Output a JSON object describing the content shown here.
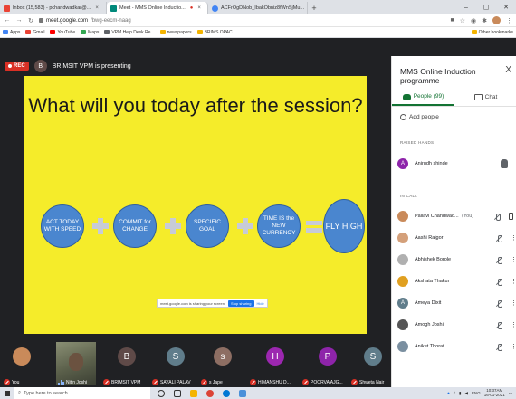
{
  "browser": {
    "tabs": [
      {
        "label": "Inbox (15,583) - pchandwadkar@...",
        "color": "#ea4335",
        "active": false
      },
      {
        "label": "Meet - MMS Online Inductio...",
        "color": "#00897b",
        "active": true
      },
      {
        "label": "ACFrOgDNob_IbakObniz8fWnSjMu...",
        "color": "#4285f4",
        "active": false
      }
    ],
    "new_tab": "+",
    "url_host": "meet.google.com",
    "url_path": "/bwg-eecm-naag",
    "bookmarks": [
      {
        "label": "Apps",
        "color": "#4285f4"
      },
      {
        "label": "Gmail",
        "color": "#ea4335"
      },
      {
        "label": "YouTube",
        "color": "#ff0000"
      },
      {
        "label": "Maps",
        "color": "#34a853"
      },
      {
        "label": "VPM Help Desk Re...",
        "color": "#5f6368"
      },
      {
        "label": "newspapers",
        "color": "#f4b400"
      },
      {
        "label": "BRIMS OPAC",
        "color": "#f4b400"
      }
    ],
    "other_bookmarks": "Other bookmarks"
  },
  "meet": {
    "rec_label": "REC",
    "presenter_initial": "B",
    "presenting_text": "BRIMSIT VPM is presenting",
    "slide": {
      "title": "What will you today after the session?",
      "steps": [
        "ACT TODAY WITH SPEED",
        "COMMIT for CHANGE",
        "SPECIFIC GOAL",
        "TIME IS the NEW CURRENCY"
      ],
      "result": "FLY HIGH"
    },
    "share_notice": "meet.google.com is sharing your screen.",
    "stop_sharing": "Stop sharing",
    "hide": "Hide",
    "participants_strip": [
      {
        "name": "You",
        "initial": "",
        "color": "#c98a5a",
        "muted": true
      },
      {
        "name": "Nitin Joshi",
        "initial": "",
        "color": "#6b5240",
        "muted": false
      },
      {
        "name": "BRIMSIT VPM",
        "initial": "B",
        "color": "#5f4a48",
        "muted": true
      },
      {
        "name": "SAYALI PALAV",
        "initial": "S",
        "color": "#607d8b",
        "muted": true
      },
      {
        "name": "s Jape",
        "initial": "s",
        "color": "#8d6e63",
        "muted": true
      },
      {
        "name": "HIMANSHU D...",
        "initial": "H",
        "color": "#9c27b0",
        "muted": true
      },
      {
        "name": "POORVA AJG...",
        "initial": "P",
        "color": "#8e24aa",
        "muted": true
      },
      {
        "name": "Shweta Nair",
        "initial": "S",
        "color": "#607d8b",
        "muted": true
      }
    ]
  },
  "panel": {
    "title": "MMS Online Induction programme",
    "close": "X",
    "tab_people": "People (99)",
    "tab_chat": "Chat",
    "add_people": "Add people",
    "raised_hands_label": "RAISED HANDS",
    "raised": [
      {
        "name": "Anirudh shinde",
        "initial": "A",
        "color": "#8e24aa"
      }
    ],
    "in_call_label": "IN CALL",
    "in_call": [
      {
        "name": "Pallavi Chandwad...",
        "you": "(You)",
        "color": "#c98a5a",
        "initial": ""
      },
      {
        "name": "Aashi Rajgor",
        "you": "",
        "color": "#d4a07a",
        "initial": ""
      },
      {
        "name": "Abhishek Borole",
        "you": "",
        "color": "#b0b0b0",
        "initial": ""
      },
      {
        "name": "Akshata Thakur",
        "you": "",
        "color": "#e0a020",
        "initial": ""
      },
      {
        "name": "Ameya Dixit",
        "you": "",
        "color": "#607d8b",
        "initial": "A"
      },
      {
        "name": "Amogh Joshi",
        "you": "",
        "color": "#555555",
        "initial": ""
      },
      {
        "name": "Aniket Thorat",
        "you": "",
        "color": "#7a8fa0",
        "initial": ""
      }
    ]
  },
  "taskbar": {
    "search_placeholder": "Type here to search",
    "lang": "ENG",
    "time": "10:37AM",
    "date": "16-01-2021"
  },
  "colors": {
    "slide_bg": "#f5ec2a",
    "circle": "#4a86cf",
    "accent_green": "#137333",
    "rec_red": "#d93025"
  }
}
